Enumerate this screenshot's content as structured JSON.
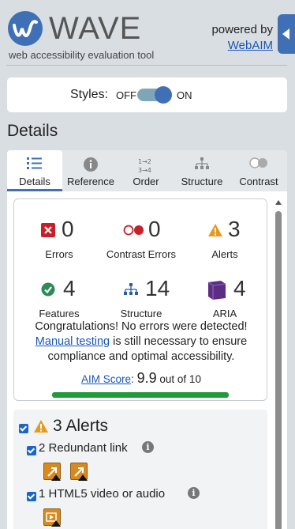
{
  "header": {
    "logo_text": "WAVE",
    "tagline": "web accessibility evaluation tool",
    "powered_by": "powered by",
    "powered_link": "WebAIM"
  },
  "styles_toggle": {
    "label": "Styles:",
    "off_label": "OFF",
    "on_label": "ON",
    "state": "ON"
  },
  "details_heading": "Details",
  "tabs": [
    {
      "label": "Details",
      "icon": "list-icon",
      "active": true
    },
    {
      "label": "Reference",
      "icon": "info-icon",
      "active": false
    },
    {
      "label": "Order",
      "icon": "order-icon",
      "active": false
    },
    {
      "label": "Structure",
      "icon": "structure-icon",
      "active": false
    },
    {
      "label": "Contrast",
      "icon": "contrast-icon",
      "active": false
    }
  ],
  "summary": {
    "errors": {
      "count": "0",
      "label": "Errors"
    },
    "contrast_errors": {
      "count": "0",
      "label": "Contrast Errors"
    },
    "alerts": {
      "count": "3",
      "label": "Alerts"
    },
    "features": {
      "count": "4",
      "label": "Features"
    },
    "structure": {
      "count": "14",
      "label": "Structure"
    },
    "aria": {
      "count": "4",
      "label": "ARIA"
    },
    "congrats_line1": "Congratulations! No errors were detected!",
    "manual_link": "Manual testing",
    "congrats_rest1": " is still necessary to ensure",
    "congrats_line3": "compliance and optimal accessibility.",
    "aim_link": "AIM Score",
    "aim_colon": ":",
    "aim_score": "9.9",
    "aim_out_of": "out of 10",
    "aim_fraction": 0.99
  },
  "alerts_section": {
    "title": "3 Alerts",
    "items": [
      {
        "label": "2 Redundant link"
      },
      {
        "label": "1 HTML5 video or audio"
      }
    ]
  },
  "colors": {
    "accent": "#3f6fb5",
    "error": "#c8202a",
    "alert": "#e69b1e",
    "feature": "#2e8b57",
    "structure": "#2a5ea8",
    "aria": "#5b2d83",
    "aim_bar": "#1f9b3a"
  }
}
